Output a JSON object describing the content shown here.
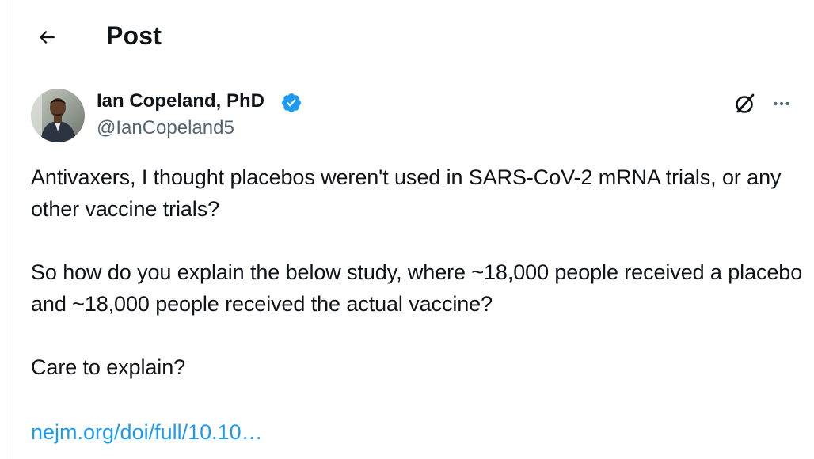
{
  "header": {
    "title": "Post",
    "back_icon": "arrow-left-icon"
  },
  "post": {
    "author": {
      "name": "Ian Copeland, PhD",
      "handle": "@IanCopeland5",
      "verified": true,
      "verified_color": "#1d9bf0"
    },
    "paragraphs": [
      "Antivaxers, I thought placebos weren't used in SARS-CoV-2 mRNA trials, or any other vaccine trials?",
      "So how do you explain the below study, where ~18,000 people received a placebo and ~18,000 people received the actual vaccine?",
      "Care to explain?"
    ],
    "link": "nejm.org/doi/full/10.10…",
    "link_color": "#1d9bf0"
  },
  "actions": {
    "grok_icon": "grok-icon",
    "more_icon": "more-horizontal-icon"
  }
}
